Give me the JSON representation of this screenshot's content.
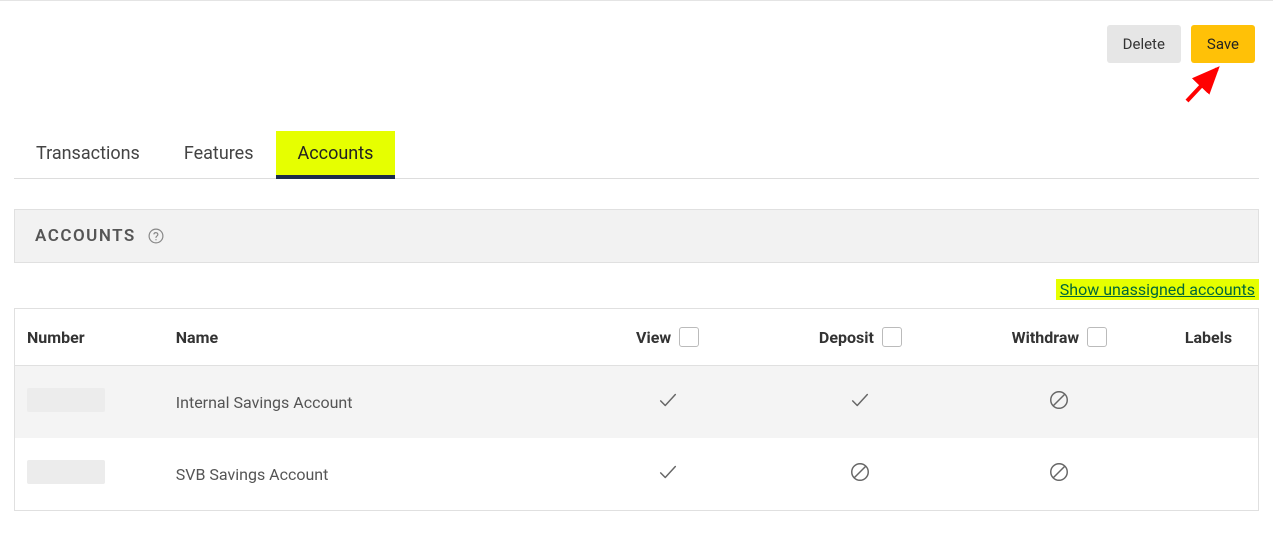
{
  "actions": {
    "delete_label": "Delete",
    "save_label": "Save"
  },
  "tabs": [
    {
      "label": "Transactions",
      "active": false,
      "highlight": false
    },
    {
      "label": "Features",
      "active": false,
      "highlight": false
    },
    {
      "label": "Accounts",
      "active": true,
      "highlight": true
    }
  ],
  "section": {
    "title": "ACCOUNTS"
  },
  "links": {
    "show_unassigned": "Show unassigned accounts"
  },
  "table": {
    "headers": {
      "number": "Number",
      "name": "Name",
      "view": "View",
      "deposit": "Deposit",
      "withdraw": "Withdraw",
      "labels": "Labels"
    },
    "rows": [
      {
        "number": "",
        "name": "Internal Savings Account",
        "view": "allowed",
        "deposit": "allowed",
        "withdraw": "denied"
      },
      {
        "number": "",
        "name": "SVB Savings Account",
        "view": "allowed",
        "deposit": "denied",
        "withdraw": "denied"
      }
    ]
  },
  "colors": {
    "highlight": "#e6ff00",
    "accent_button": "#ffc107",
    "link_green": "#006838",
    "tab_underline": "#1a2b4a",
    "annotation_arrow": "#ff0000"
  }
}
